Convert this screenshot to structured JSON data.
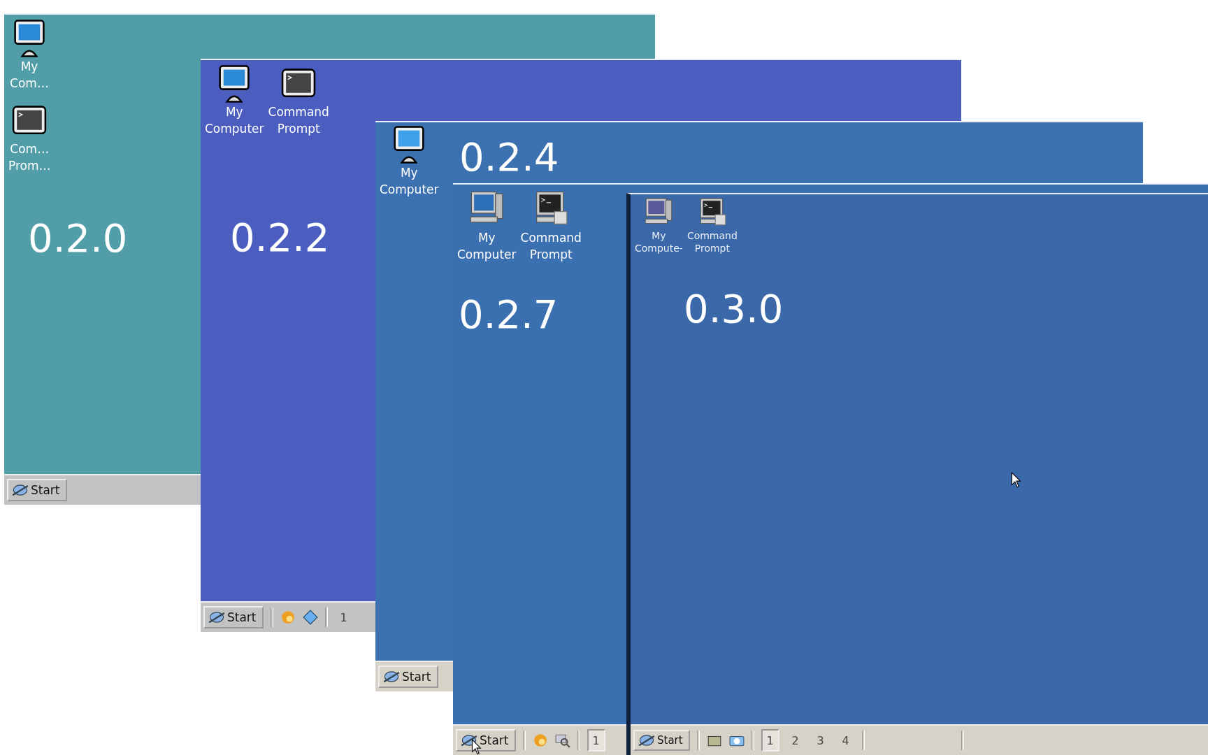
{
  "desktops": [
    {
      "version": "0.2.0",
      "color": "#519ea9",
      "icons": [
        {
          "kind": "computer",
          "label": "My Com…"
        },
        {
          "kind": "terminal",
          "label": "Com… Prom…"
        }
      ],
      "taskbar": {
        "start": "Start"
      }
    },
    {
      "version": "0.2.2",
      "color": "#4b5ebf",
      "icons": [
        {
          "kind": "computer",
          "label": "My Computer"
        },
        {
          "kind": "terminal",
          "label": "Command Prompt"
        }
      ],
      "taskbar": {
        "start": "Start",
        "quick_launch": [
          {
            "kind": "browser"
          },
          {
            "kind": "diamond"
          }
        ],
        "pager": [
          {
            "label": "1",
            "selected": false
          }
        ]
      }
    },
    {
      "version": "0.2.4",
      "color": "#3b71b0",
      "icons": [
        {
          "kind": "computer",
          "label": "My Computer"
        }
      ],
      "taskbar": {
        "start": "Start"
      }
    },
    {
      "version": "0.2.7",
      "color": "#3a70b0",
      "icons": [
        {
          "kind": "computer",
          "label": "My Computer"
        },
        {
          "kind": "terminal",
          "label": "Command Prompt"
        }
      ],
      "taskbar": {
        "start": "Start",
        "quick_launch": [
          {
            "kind": "browser"
          },
          {
            "kind": "search"
          }
        ],
        "pager": [
          {
            "label": "1",
            "selected": true
          }
        ]
      }
    },
    {
      "version": "0.3.0",
      "color": "#3a68a8",
      "icons": [
        {
          "kind": "computer",
          "label": "My Compute-"
        },
        {
          "kind": "terminal",
          "label": "Command Prompt"
        }
      ],
      "taskbar": {
        "start": "Start",
        "quick_launch": [
          {
            "kind": "folder"
          },
          {
            "kind": "camera"
          }
        ],
        "pager": [
          {
            "label": "1",
            "selected": true
          },
          {
            "label": "2",
            "selected": false
          },
          {
            "label": "3",
            "selected": false
          },
          {
            "label": "4",
            "selected": false
          }
        ]
      }
    }
  ]
}
